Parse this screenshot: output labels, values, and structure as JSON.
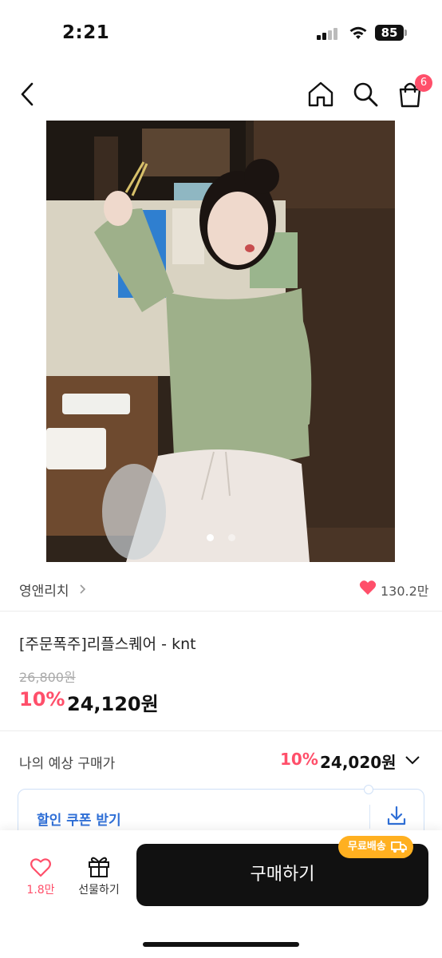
{
  "status_bar": {
    "time": "2:21",
    "battery": "85"
  },
  "nav": {
    "cart_count": "6"
  },
  "product": {
    "image_count": 2,
    "active_image": 1,
    "brand": "영앤리치",
    "likes": "130.2만",
    "title": "[주문폭주]리플스퀘어 - knt",
    "original_price": "26,800원",
    "discount_rate": "10%",
    "sale_price": "24,120원"
  },
  "expected_price": {
    "label": "나의 예상 구매가",
    "rate": "10%",
    "price": "24,020원"
  },
  "coupon": {
    "label": "할인 쿠폰 받기"
  },
  "bottom_bar": {
    "wish_count": "1.8만",
    "gift_label": "선물하기",
    "buy_label": "구매하기",
    "free_shipping_badge": "무료배송"
  },
  "colors": {
    "accent": "#ff4f6a",
    "coupon_blue": "#2f6fd6",
    "free_ship": "#ffb020",
    "buy_button": "#111111"
  }
}
